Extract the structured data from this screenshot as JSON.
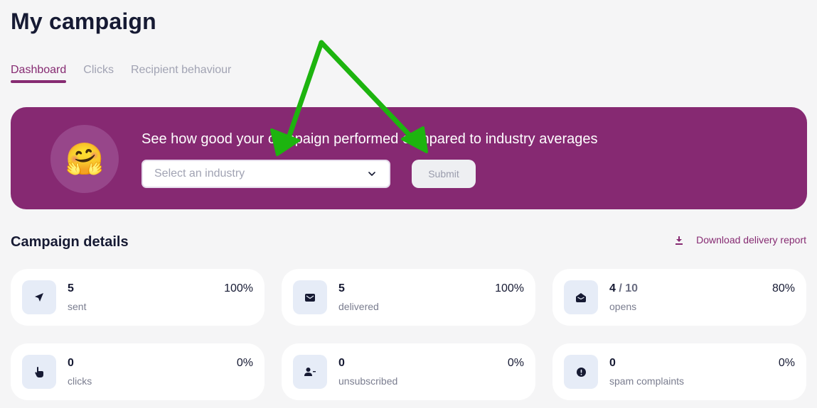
{
  "page": {
    "title": "My campaign"
  },
  "tabs": [
    {
      "label": "Dashboard",
      "active": true
    },
    {
      "label": "Clicks",
      "active": false
    },
    {
      "label": "Recipient behaviour",
      "active": false
    }
  ],
  "banner": {
    "emoji": "🤗",
    "emoji_icon": "hugging-face-emoji",
    "text": "See how good your campaign performed compared to industry averages",
    "industry_select": {
      "placeholder": "Select an industry",
      "value": ""
    },
    "submit_label": "Submit",
    "background_color": "#862972"
  },
  "details": {
    "title": "Campaign details",
    "download_label": "Download delivery report",
    "download_icon": "download-icon",
    "cards": [
      {
        "icon": "send-icon",
        "value": "5",
        "total": "",
        "label": "sent",
        "percent": "100%"
      },
      {
        "icon": "envelope-icon",
        "value": "5",
        "total": "",
        "label": "delivered",
        "percent": "100%"
      },
      {
        "icon": "envelope-open-icon",
        "value": "4",
        "total": "/ 10",
        "label": "opens",
        "percent": "80%"
      },
      {
        "icon": "pointer-hand-icon",
        "value": "0",
        "total": "",
        "label": "clicks",
        "percent": "0%"
      },
      {
        "icon": "user-minus-icon",
        "value": "0",
        "total": "",
        "label": "unsubscribed",
        "percent": "0%"
      },
      {
        "icon": "alert-circle-icon",
        "value": "0",
        "total": "",
        "label": "spam complaints",
        "percent": "0%"
      }
    ]
  },
  "colors": {
    "accent": "#862b72",
    "text_dark": "#161a33",
    "icon_bg": "#e6ecf7",
    "annotation_arrow": "#1db40f"
  }
}
